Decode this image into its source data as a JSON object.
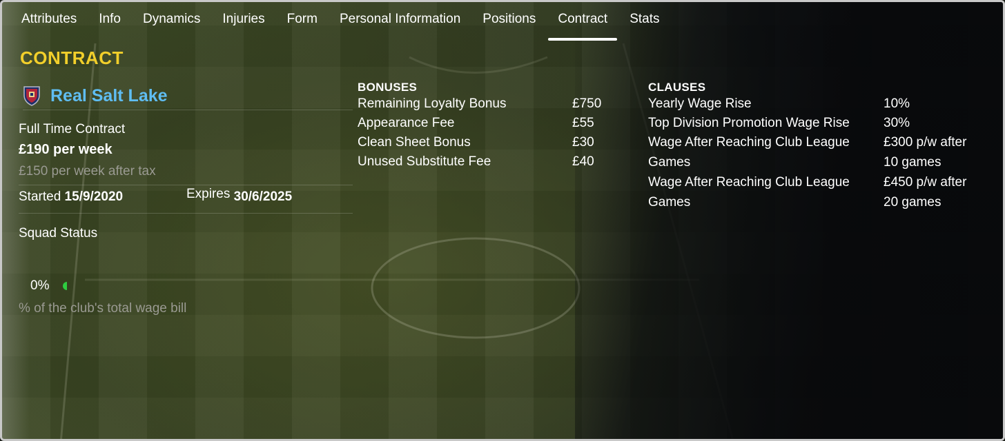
{
  "tabs": [
    {
      "label": "Attributes"
    },
    {
      "label": "Info"
    },
    {
      "label": "Dynamics"
    },
    {
      "label": "Injuries"
    },
    {
      "label": "Form"
    },
    {
      "label": "Personal Information"
    },
    {
      "label": "Positions"
    },
    {
      "label": "Contract",
      "active": true
    },
    {
      "label": "Stats"
    }
  ],
  "section_title": "CONTRACT",
  "club": {
    "name": "Real Salt Lake",
    "icon": "club-crest-icon"
  },
  "contract": {
    "type": "Full Time Contract",
    "wage": "£190 per week",
    "wage_after_tax": "£150 per week after tax",
    "started_label": "Started",
    "started_value": "15/9/2020",
    "expires_label": "Expires",
    "expires_value": "30/6/2025",
    "squad_status_label": "Squad Status",
    "wage_bill_percent": "0%",
    "wage_bill_fraction": 0.0,
    "wage_bill_label": "% of the club's total wage bill"
  },
  "bonuses": {
    "heading": "BONUSES",
    "items": [
      {
        "label": "Remaining Loyalty Bonus",
        "value": "£750"
      },
      {
        "label": "Appearance Fee",
        "value": "£55"
      },
      {
        "label": "Clean Sheet Bonus",
        "value": "£30"
      },
      {
        "label": "Unused Substitute Fee",
        "value": "£40"
      }
    ]
  },
  "clauses": {
    "heading": "CLAUSES",
    "items": [
      {
        "label": "Yearly Wage Rise",
        "value": "10%"
      },
      {
        "label": "Top Division Promotion Wage Rise",
        "value": "30%"
      },
      {
        "label": "Wage After Reaching Club League",
        "label2": "Games",
        "value": "£300 p/w after",
        "value2": "10 games"
      },
      {
        "label": "Wage After Reaching Club League",
        "label2": "Games",
        "value": "£450 p/w after",
        "value2": "20 games"
      }
    ]
  },
  "colors": {
    "title": "#f2cf2b",
    "club": "#5fbdf2",
    "accent": "#2ecc40"
  }
}
